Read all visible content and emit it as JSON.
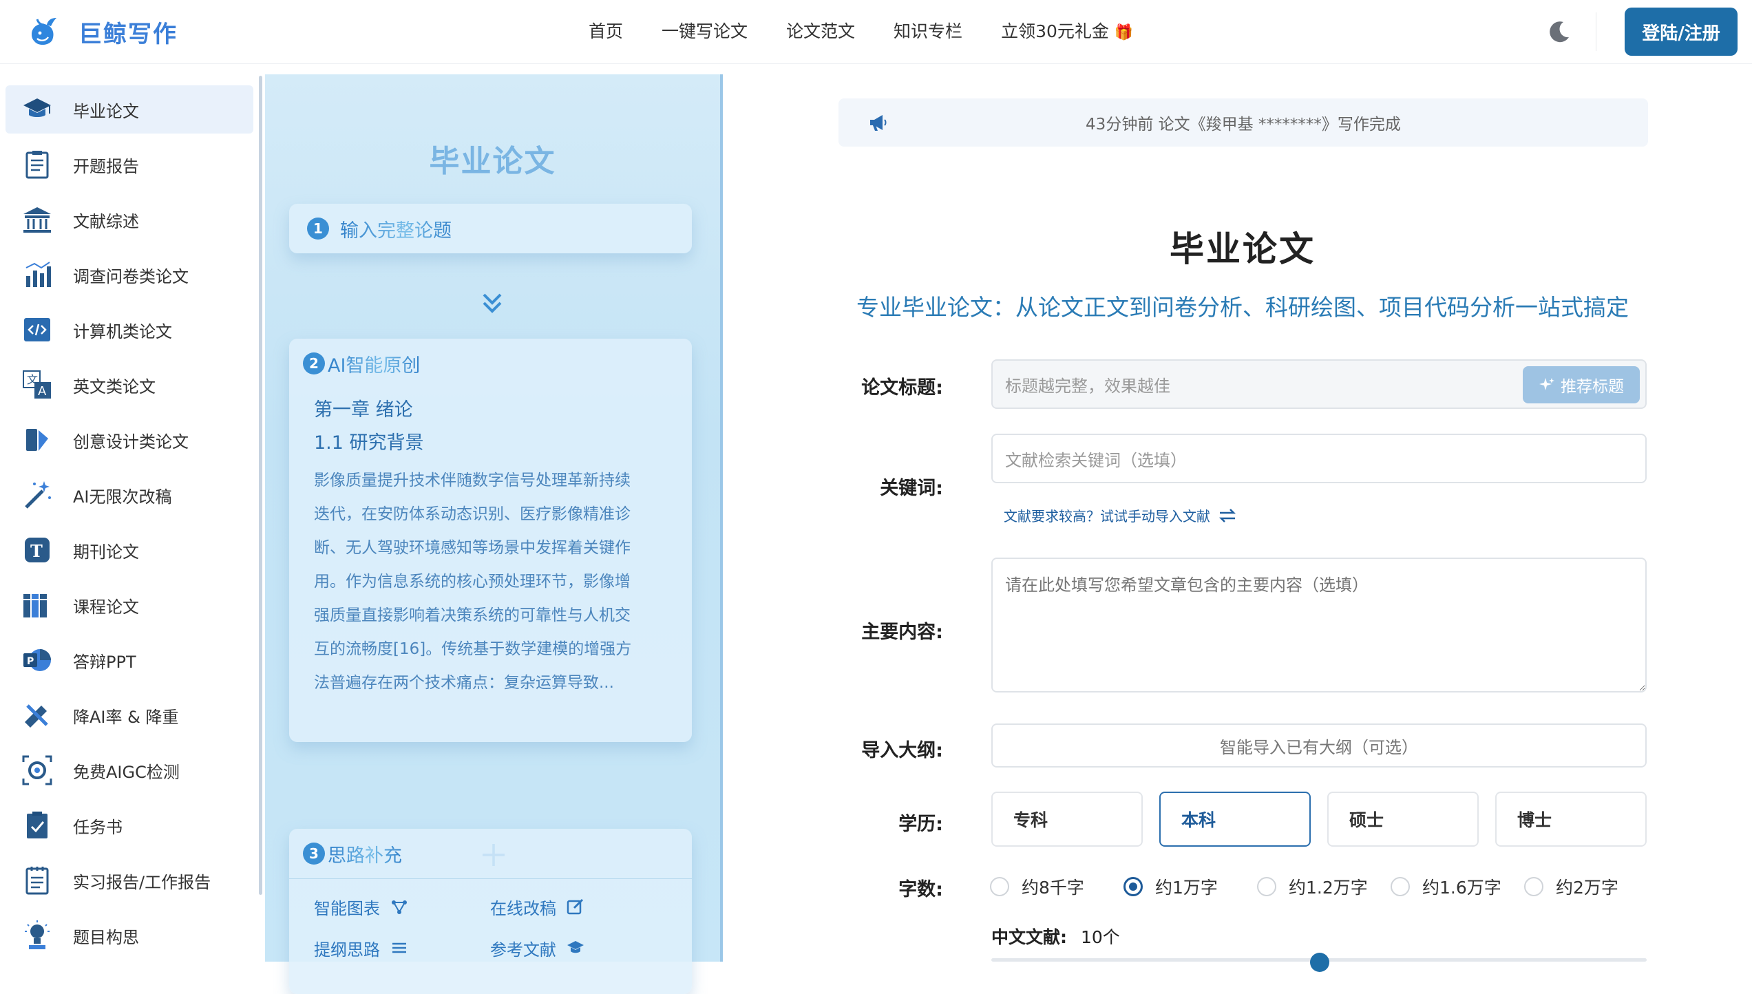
{
  "brand": "巨鲸写作",
  "nav": [
    "首页",
    "一键写论文",
    "论文范文",
    "知识专栏",
    "立领30元礼金"
  ],
  "login": "登陆/注册",
  "sidebar": [
    {
      "label": "毕业论文",
      "icon": "graduation-cap-icon"
    },
    {
      "label": "开题报告",
      "icon": "clipboard-list-icon"
    },
    {
      "label": "文献综述",
      "icon": "library-icon"
    },
    {
      "label": "调查问卷类论文",
      "icon": "bar-chart-icon"
    },
    {
      "label": "计算机类论文",
      "icon": "code-icon"
    },
    {
      "label": "英文类论文",
      "icon": "translate-icon"
    },
    {
      "label": "创意设计类论文",
      "icon": "design-icon"
    },
    {
      "label": "AI无限次改稿",
      "icon": "magic-wand-icon"
    },
    {
      "label": "期刊论文",
      "icon": "journal-icon"
    },
    {
      "label": "课程论文",
      "icon": "books-icon"
    },
    {
      "label": "答辩PPT",
      "icon": "powerpoint-icon"
    },
    {
      "label": "降AI率 & 降重",
      "icon": "pen-ruler-icon"
    },
    {
      "label": "免费AIGC检测",
      "icon": "scan-gear-icon"
    },
    {
      "label": "任务书",
      "icon": "clipboard-check-icon"
    },
    {
      "label": "实习报告/工作报告",
      "icon": "report-icon"
    },
    {
      "label": "题目构思",
      "icon": "lightbulb-icon"
    }
  ],
  "demo": {
    "title": "毕业论文",
    "step1": {
      "num": "1",
      "text": "输入完整论题"
    },
    "step2": {
      "num": "2",
      "text": "AI智能原创",
      "heading1": "第一章 绪论",
      "heading2": "1.1 研究背景",
      "lines": [
        "影像质量提升技术伴随数字信号处理革新持续",
        "迭代，在安防体系动态识别、医疗影像精准诊",
        "断、无人驾驶环境感知等场景中发挥着关键作",
        "用。作为信息系统的核心预处理环节，影像增",
        "强质量直接影响着决策系统的可靠性与人机交",
        "互的流畅度[16]。传统基于数学建模的增强方",
        "法普遍存在两个技术痛点：复杂运算导致..."
      ]
    },
    "step3": {
      "num": "3",
      "text": "思路补充",
      "items": [
        "智能图表",
        "在线改稿",
        "提纲思路",
        "参考文献"
      ]
    }
  },
  "notice": "43分钟前 论文《羧甲基 ********》写作完成",
  "main": {
    "title": "毕业论文",
    "subtitle": "专业毕业论文：从论文正文到问卷分析、科研绘图、项目代码分析一站式搞定",
    "title_label": "论文标题:",
    "title_placeholder": "标题越完整，效果越佳",
    "recommend": "推荐标题",
    "keyword_label": "关键词:",
    "keyword_placeholder": "文献检索关键词（选填）",
    "hint": "文献要求较高？试试手动导入文献",
    "content_label": "主要内容:",
    "content_placeholder": "请在此处填写您希望文章包含的主要内容（选填）",
    "outline_label": "导入大纲:",
    "outline_button": "智能导入已有大纲（可选）",
    "edu_label": "学历:",
    "edu_options": [
      "专科",
      "本科",
      "硕士",
      "博士"
    ],
    "edu_selected": "本科",
    "words_label": "字数:",
    "word_options": [
      "约8千字",
      "约1万字",
      "约1.2万字",
      "约1.6万字",
      "约2万字"
    ],
    "word_selected": "约1万字",
    "cn_lit_label": "中文文献:",
    "cn_lit_value": "10个"
  },
  "colors": {
    "accent": "#1e6ea8",
    "brand": "#3b7fd8",
    "demo_bg": "#c7e6f7"
  }
}
